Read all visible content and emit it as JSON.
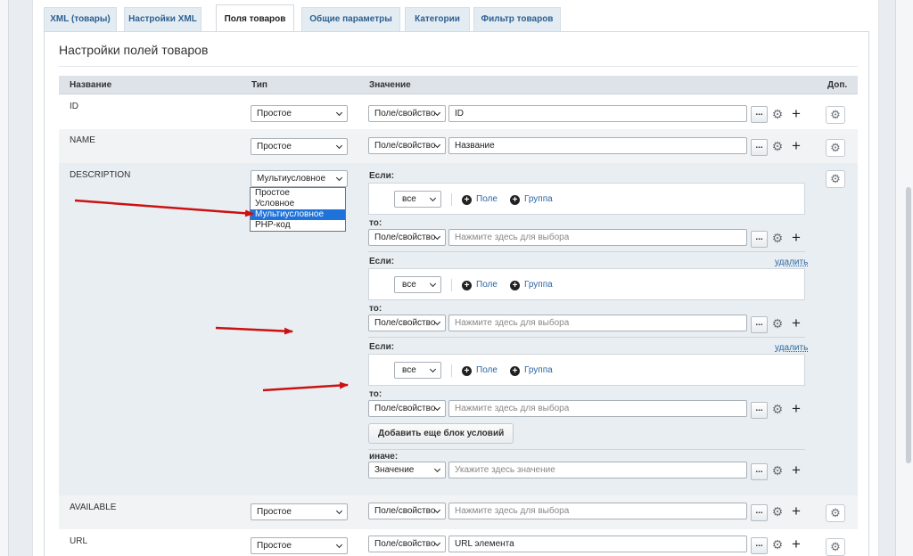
{
  "tabs": [
    {
      "label": "XML (товары)"
    },
    {
      "label": "Настройки XML"
    },
    {
      "label": "Поля товаров"
    },
    {
      "label": "Общие параметры"
    },
    {
      "label": "Категории"
    },
    {
      "label": "Фильтр товаров"
    }
  ],
  "active_tab": "Поля товаров",
  "panel_title": "Настройки полей товаров",
  "table": {
    "headers": {
      "name": "Название",
      "type": "Тип",
      "value": "Значение",
      "extra": "Доп."
    }
  },
  "rows": [
    {
      "name": "ID",
      "type": "Простое",
      "source": "Поле/свойство",
      "value": "ID"
    },
    {
      "name": "NAME",
      "type": "Простое",
      "source": "Поле/свойство",
      "value": "Название"
    },
    {
      "name": "DESCRIPTION",
      "type": "Мультиусловное"
    },
    {
      "name": "AVAILABLE",
      "type": "Простое",
      "source": "Поле/свойство",
      "value_placeholder": "Нажмите здесь для выбора"
    },
    {
      "name": "URL",
      "type": "Простое",
      "source": "Поле/свойство",
      "value": "URL элемента"
    }
  ],
  "type_dropdown": {
    "options": [
      "Простое",
      "Условное",
      "Мультиусловное",
      "PHP-код"
    ],
    "selected": "Мультиусловное"
  },
  "conditions": {
    "if_label": "Если:",
    "then_label": "то:",
    "else_label": "иначе:",
    "delete_label": "удалить",
    "logic_value": "все",
    "add_field": "Поле",
    "add_group": "Группа",
    "source": "Поле/свойство",
    "value_placeholder": "Нажмите здесь для выбора",
    "add_block_button": "Добавить еще блок условий",
    "else_source": "Значение",
    "else_placeholder": "Укажите здесь значение"
  },
  "icons": {
    "more": "...",
    "settings": "gear-icon",
    "add": "plus-icon"
  },
  "colors": {
    "arrow": "#cc1111",
    "link": "#2d67a3",
    "tab_text": "#2d5f8f",
    "dropdown_highlight": "#1e72d9"
  }
}
